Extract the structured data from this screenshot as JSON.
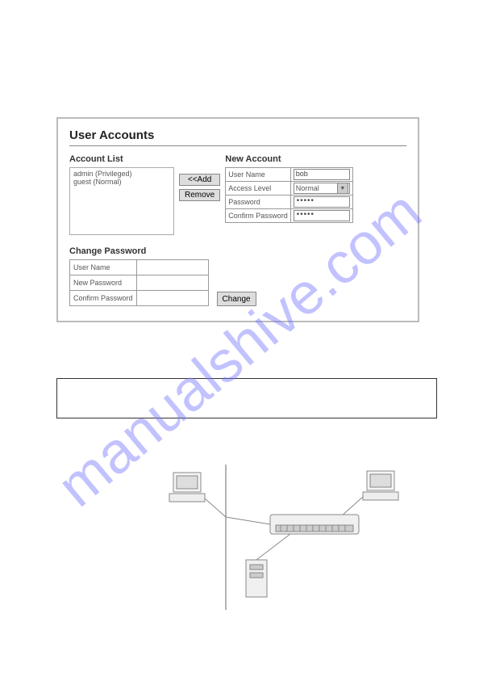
{
  "watermark": "manualshive.com",
  "panel": {
    "title": "User Accounts",
    "account_list": {
      "heading": "Account List",
      "items": [
        "admin (Privileged)",
        "guest (Normal)"
      ]
    },
    "buttons": {
      "add": "<<Add",
      "remove": "Remove",
      "change": "Change"
    },
    "new_account": {
      "heading": "New Account",
      "user_name_label": "User Name",
      "user_name_value": "bob",
      "access_level_label": "Access Level",
      "access_level_value": "Normal",
      "password_label": "Password",
      "password_value": "•••••",
      "confirm_label": "Confirm Password",
      "confirm_value": "•••••"
    },
    "change_password": {
      "heading": "Change Password",
      "user_name_label": "User Name",
      "new_password_label": "New Password",
      "confirm_label": "Confirm Password"
    }
  }
}
